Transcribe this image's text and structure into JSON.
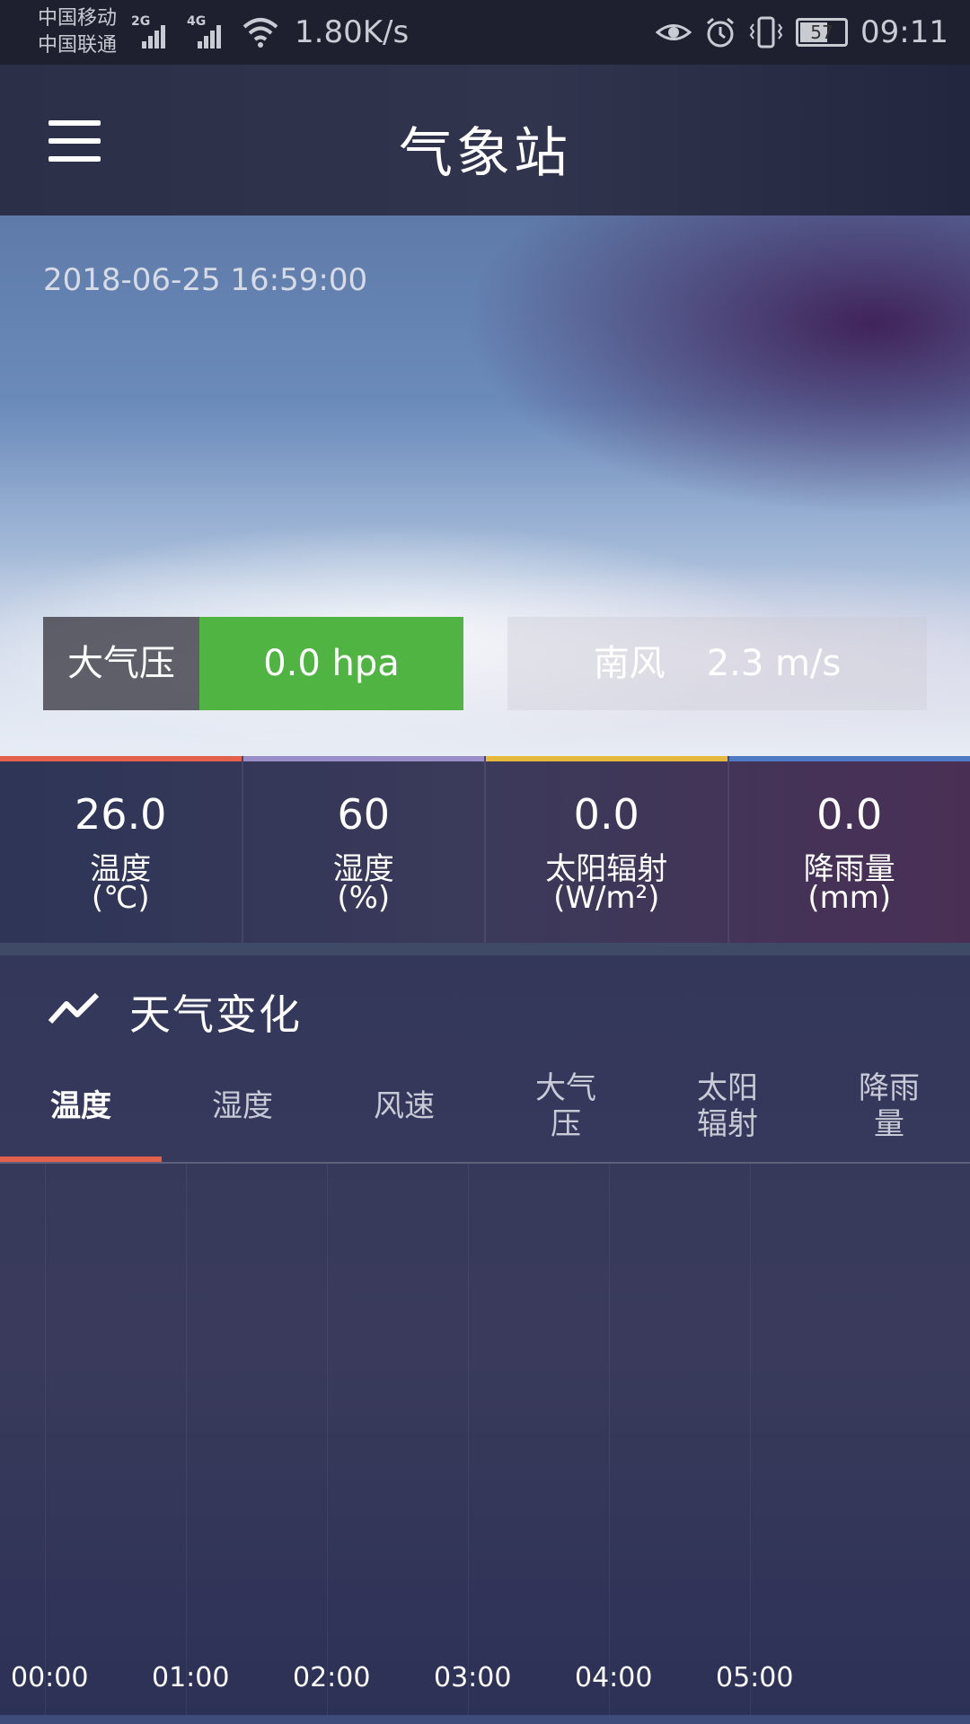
{
  "status_bar": {
    "carrier1": "中国移动",
    "carrier2": "中国联通",
    "net1": "2G",
    "net2": "4G",
    "speed": "1.80K/s",
    "battery": "57",
    "time": "09:11"
  },
  "app": {
    "title": "气象站"
  },
  "hero": {
    "timestamp": "2018-06-25 16:59:00",
    "pressure_label": "大气压",
    "pressure_value": "0.0 hpa",
    "wind_direction": "南风",
    "wind_speed": "2.3 m/s"
  },
  "metrics": [
    {
      "value": "26.0",
      "name": "温度",
      "unit": "(℃)",
      "color": "#e4624b"
    },
    {
      "value": "60",
      "name": "湿度",
      "unit": "(%)",
      "color": "#9b8fc9"
    },
    {
      "value": "0.0",
      "name": "太阳辐射",
      "unit": "(W/m²)",
      "color": "#e6b83c"
    },
    {
      "value": "0.0",
      "name": "降雨量",
      "unit": "(mm)",
      "color": "#4f7ac6"
    }
  ],
  "section": {
    "title": "天气变化",
    "tabs": [
      {
        "line1": "温度",
        "line2": ""
      },
      {
        "line1": "湿度",
        "line2": ""
      },
      {
        "line1": "风速",
        "line2": ""
      },
      {
        "line1": "大气",
        "line2": "压"
      },
      {
        "line1": "太阳",
        "line2": "辐射"
      },
      {
        "line1": "降雨",
        "line2": "量"
      }
    ],
    "active_tab": 0
  },
  "chart_data": {
    "type": "line",
    "x": [
      "00:00",
      "01:00",
      "02:00",
      "03:00",
      "04:00",
      "05:00"
    ],
    "series": []
  }
}
